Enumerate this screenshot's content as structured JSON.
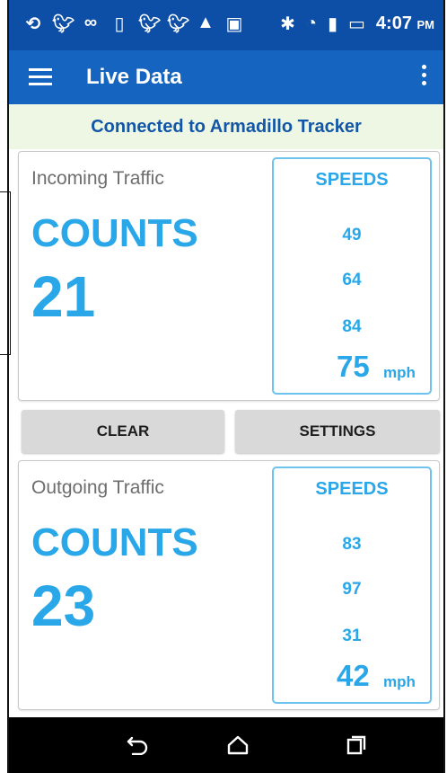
{
  "status_bar": {
    "icons": [
      "sync-icon",
      "twitter-icon",
      "voicemail-icon",
      "phone-icon",
      "twitter-icon",
      "twitter-icon",
      "warning-icon",
      "photo-icon"
    ],
    "right_icons": [
      "bluetooth-icon",
      "wifi-icon",
      "signal-icon",
      "battery-icon"
    ],
    "time": "4:07",
    "ampm": "PM"
  },
  "app_bar": {
    "title": "Live Data"
  },
  "banner": {
    "text": "Connected to Armadillo Tracker"
  },
  "incoming": {
    "label": "Incoming Traffic",
    "counts_label": "COUNTS",
    "count": "21",
    "speeds_header": "SPEEDS",
    "speeds": [
      "49",
      "64",
      "84"
    ],
    "current_speed": "75",
    "unit": "mph"
  },
  "buttons": {
    "clear": "CLEAR",
    "settings": "SETTINGS"
  },
  "outgoing": {
    "label": "Outgoing Traffic",
    "counts_label": "COUNTS",
    "count": "23",
    "speeds_header": "SPEEDS",
    "speeds": [
      "83",
      "97",
      "31"
    ],
    "current_speed": "42",
    "unit": "mph"
  },
  "nav_bar": {
    "buttons": [
      "back-icon",
      "home-icon",
      "recent-apps-icon"
    ]
  },
  "colors": {
    "status_bar": "#0d4fa6",
    "app_bar": "#1565c0",
    "accent": "#2aa7e8",
    "banner_bg": "#eef7e4",
    "banner_text": "#1256a8"
  }
}
